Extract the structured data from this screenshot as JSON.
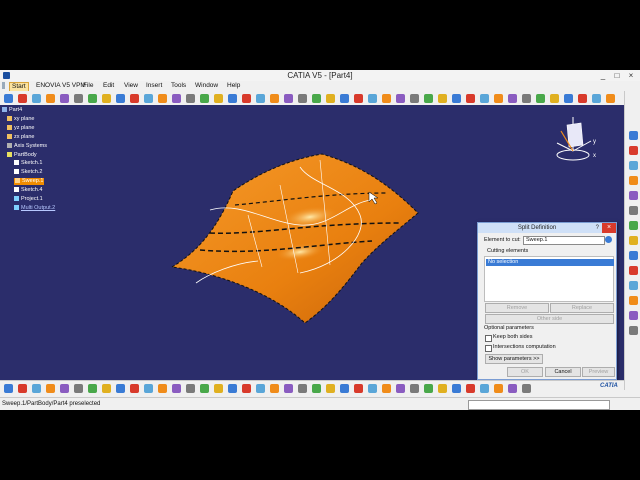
{
  "window": {
    "title": "CATIA V5 - [Part4]",
    "controls": [
      "_",
      "□",
      "×"
    ]
  },
  "menu": [
    "Start",
    "ENOVIA V5 VPM",
    "File",
    "Edit",
    "View",
    "Insert",
    "Tools",
    "Window",
    "Help"
  ],
  "tree": {
    "items": [
      "Part4",
      "xy plane",
      "yz plane",
      "zx plane",
      "Axis Systems",
      "PartBody",
      "Sketch.1",
      "Sketch.2",
      "Sweep.1",
      "Sketch.4",
      "Project.1",
      "Multi Output.2"
    ]
  },
  "compass": {
    "x": "x",
    "y": "y"
  },
  "dialog": {
    "title": "Split Definition",
    "help": "?",
    "close": "×",
    "element_label": "Element to cut:",
    "element_value": "Sweep.1",
    "cutting_label": "Cutting elements",
    "cutting_selected": "No selection",
    "remove_label": "Remove",
    "replace_label": "Replace",
    "other_side_label": "Other side",
    "optional_label": "Optional parameters",
    "keep_both_label": "Keep both sides",
    "intersections_label": "Intersections computation",
    "show_params_label": "Show parameters >>",
    "ok_label": "OK",
    "cancel_label": "Cancel",
    "preview_label": "Preview"
  },
  "status": {
    "message": "Sweep.1/PartBody/Part4 preselected",
    "brand": "CATIA"
  },
  "colors": {
    "viewport": "#2b2d6b",
    "surface": "#f08c1a",
    "accent": "#3a7bd5"
  }
}
